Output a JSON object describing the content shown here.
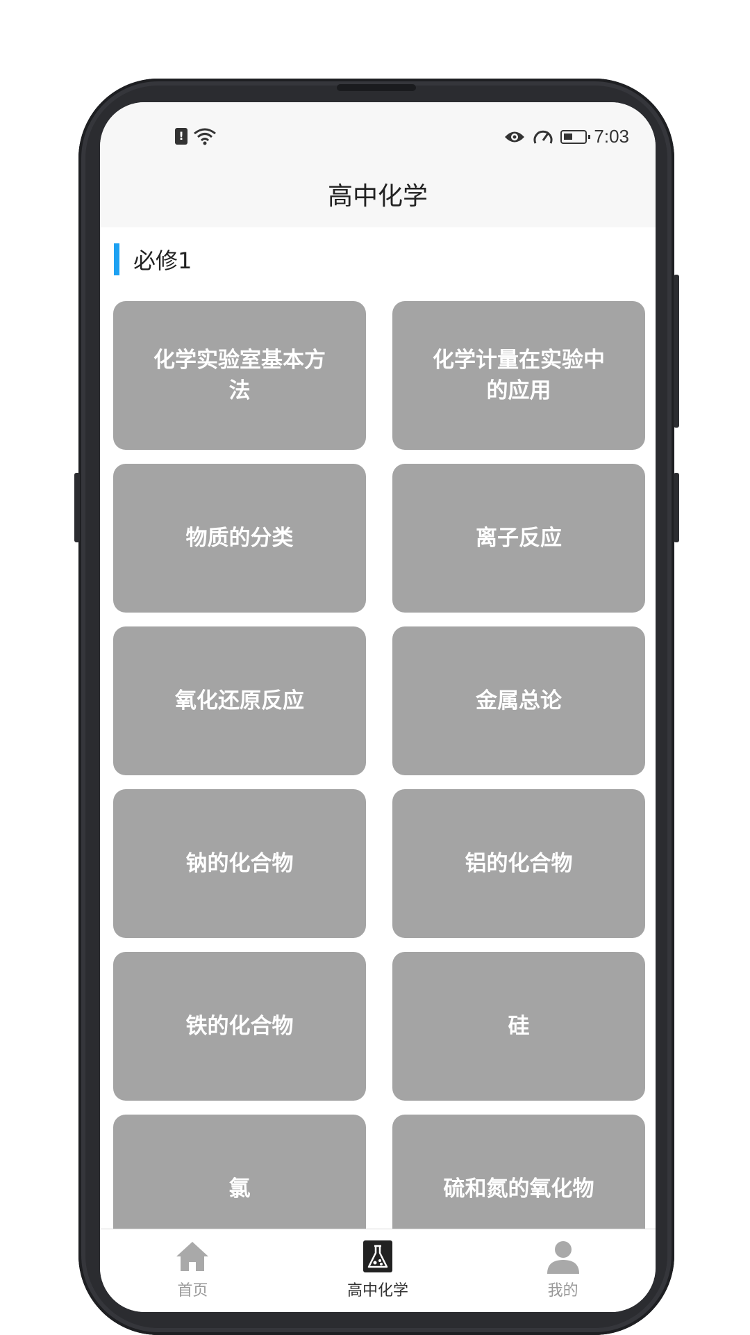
{
  "status_bar": {
    "time": "7:03",
    "sim_icon": "sim-alert-icon",
    "wifi_icon": "wifi-icon",
    "eye_icon": "eye-icon",
    "speed_icon": "speedometer-icon",
    "battery_icon": "battery-icon"
  },
  "header": {
    "title": "高中化学"
  },
  "section": {
    "title": "必修1",
    "accent_color": "#1da1f2"
  },
  "cards": [
    {
      "label": "化学实验室基本方法"
    },
    {
      "label": "化学计量在实验中的应用"
    },
    {
      "label": "物质的分类"
    },
    {
      "label": "离子反应"
    },
    {
      "label": "氧化还原反应"
    },
    {
      "label": "金属总论"
    },
    {
      "label": "钠的化合物"
    },
    {
      "label": "铝的化合物"
    },
    {
      "label": "铁的化合物"
    },
    {
      "label": "硅"
    },
    {
      "label": "氯"
    },
    {
      "label": "硫和氮的氧化物"
    }
  ],
  "tabs": [
    {
      "label": "首页",
      "icon": "home-icon",
      "active": false
    },
    {
      "label": "高中化学",
      "icon": "flask-icon",
      "active": true
    },
    {
      "label": "我的",
      "icon": "user-icon",
      "active": false
    }
  ],
  "colors": {
    "card_bg": "#a4a4a4",
    "card_text": "#ffffff",
    "tab_active": "#333333",
    "tab_inactive": "#999999"
  }
}
